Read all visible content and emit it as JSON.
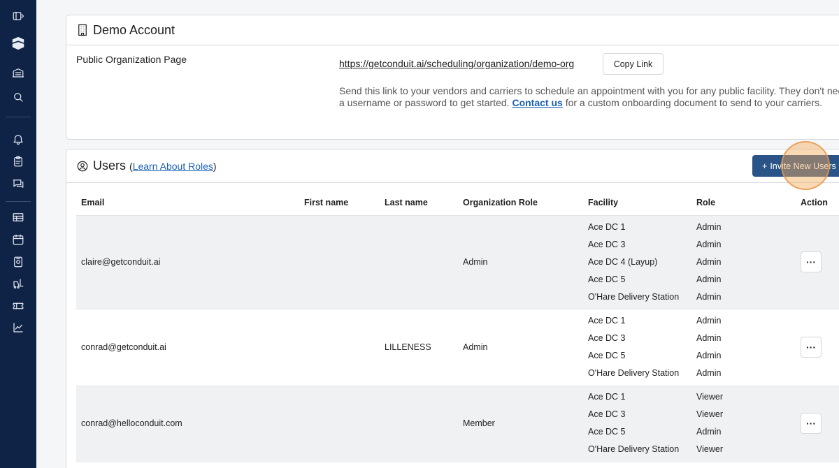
{
  "sidebar": {
    "items": [
      {
        "name": "sidebar-toggle-icon"
      },
      {
        "name": "logo-icon"
      },
      {
        "name": "warehouse-icon"
      },
      {
        "name": "search-icon"
      },
      {
        "name": "bell-icon"
      },
      {
        "name": "clipboard-icon"
      },
      {
        "name": "chat-icon"
      },
      {
        "name": "list-icon"
      },
      {
        "name": "calendar-icon"
      },
      {
        "name": "dock-icon"
      },
      {
        "name": "forklift-icon"
      },
      {
        "name": "ticket-icon"
      },
      {
        "name": "chart-icon"
      }
    ]
  },
  "org": {
    "title": "Demo Account",
    "public_label": "Public Organization Page",
    "link": "https://getconduit.ai/scheduling/organization/demo-org",
    "copy_label": "Copy Link",
    "desc_before": "Send this link to your vendors and carriers to schedule an appointment with you for any public facility. They don't need a username or password to get started. ",
    "contact_label": "Contact us",
    "desc_after": " for a custom onboarding document to send to your carriers."
  },
  "users": {
    "title": "Users",
    "paren_open": "(",
    "learn_label": "Learn About Roles",
    "paren_close": ")",
    "invite_label": "Invite New Users",
    "columns": [
      "Email",
      "First name",
      "Last name",
      "Organization Role",
      "Facility",
      "Role",
      "Action"
    ],
    "rows": [
      {
        "email": "claire@getconduit.ai",
        "first_name": "",
        "last_name": "",
        "org_role": "Admin",
        "facilities": [
          {
            "facility": "Ace DC 1",
            "role": "Admin"
          },
          {
            "facility": "Ace DC 3",
            "role": "Admin"
          },
          {
            "facility": "Ace DC 4 (Layup)",
            "role": "Admin"
          },
          {
            "facility": "Ace DC 5",
            "role": "Admin"
          },
          {
            "facility": "O'Hare Delivery Station",
            "role": "Admin"
          }
        ],
        "action": "···"
      },
      {
        "email": "conrad@getconduit.ai",
        "first_name": "",
        "last_name": "LILLENESS",
        "org_role": "Admin",
        "facilities": [
          {
            "facility": "Ace DC 1",
            "role": "Admin"
          },
          {
            "facility": "Ace DC 3",
            "role": "Admin"
          },
          {
            "facility": "Ace DC 5",
            "role": "Admin"
          },
          {
            "facility": "O'Hare Delivery Station",
            "role": "Admin"
          }
        ],
        "action": "···"
      },
      {
        "email": "conrad@helloconduit.com",
        "first_name": "",
        "last_name": "",
        "org_role": "Member",
        "facilities": [
          {
            "facility": "Ace DC 1",
            "role": "Viewer"
          },
          {
            "facility": "Ace DC 3",
            "role": "Viewer"
          },
          {
            "facility": "Ace DC 5",
            "role": "Admin"
          },
          {
            "facility": "O'Hare Delivery Station",
            "role": "Viewer"
          }
        ],
        "action": "···"
      }
    ]
  },
  "colors": {
    "sidebar": "#0f2347",
    "accent": "#2a5488",
    "link": "#1a5fb4",
    "highlight": "#f4aa5a"
  }
}
